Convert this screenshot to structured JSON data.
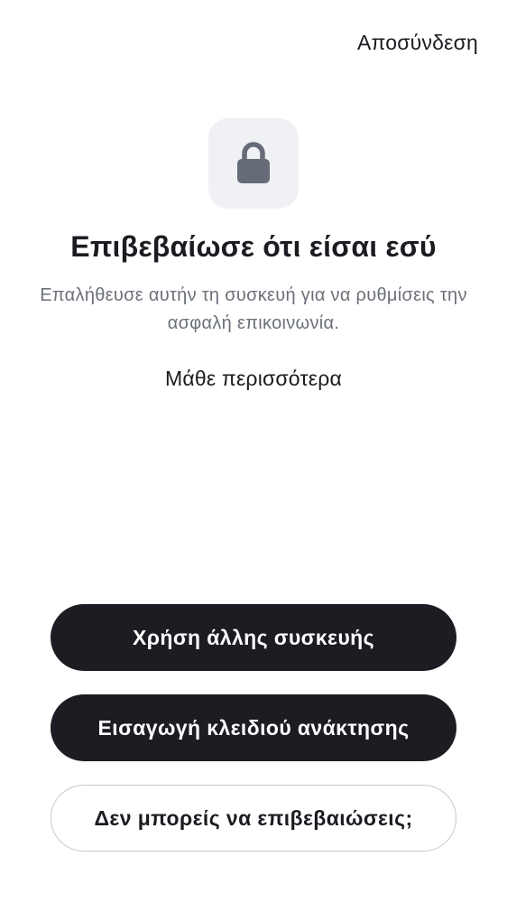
{
  "header": {
    "signout_label": "Αποσύνδεση"
  },
  "hero": {
    "icon": "lock-icon",
    "title": "Επιβεβαίωσε ότι είσαι εσύ",
    "subtitle": "Επαλήθευσε αυτήν τη συσκευή για να ρυθμίσεις την ασφαλή επικοινωνία.",
    "learn_more_label": "Μάθε περισσότερα"
  },
  "actions": {
    "use_other_device_label": "Χρήση άλλης συσκευής",
    "enter_recovery_key_label": "Εισαγωγή κλειδιού ανάκτησης",
    "cant_confirm_label": "Δεν μπορείς να επιβεβαιώσεις;"
  },
  "colors": {
    "primary_button": "#1b1d22",
    "icon_tile": "#eff1f5",
    "icon": "#656c78",
    "subtitle_text": "#6b7079"
  }
}
